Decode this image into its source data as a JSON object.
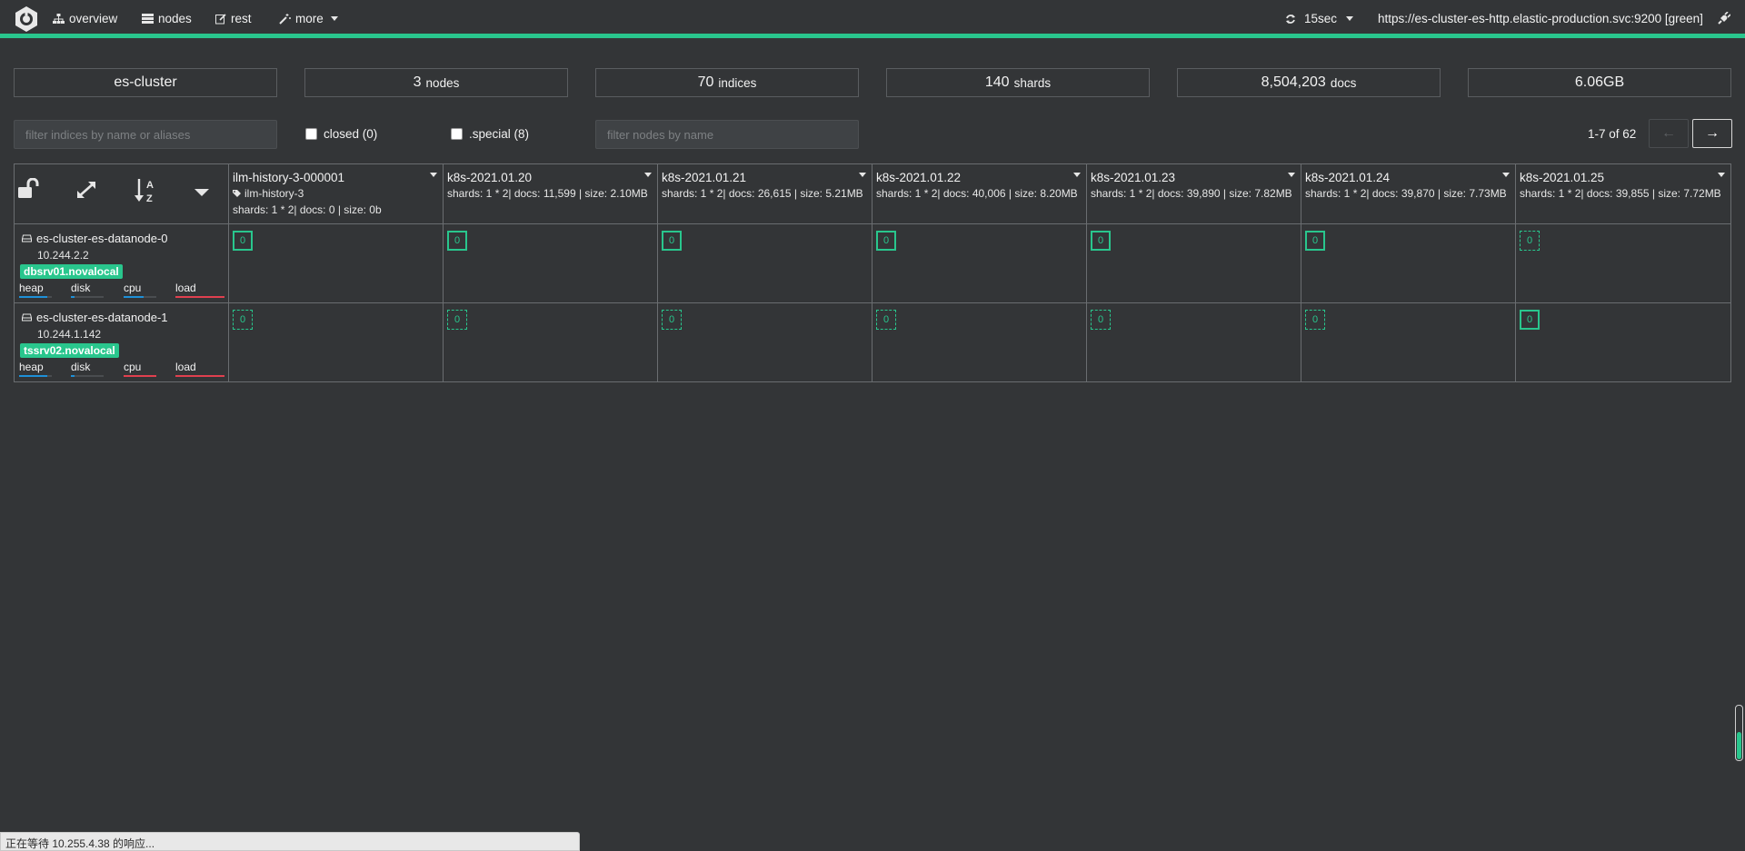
{
  "nav": {
    "items": [
      {
        "label": "overview",
        "icon": "sitemap-icon"
      },
      {
        "label": "nodes",
        "icon": "server-icon"
      },
      {
        "label": "rest",
        "icon": "edit-icon"
      },
      {
        "label": "more",
        "icon": "magic-wand-icon"
      }
    ],
    "refresh": "15sec",
    "cluster_url": "https://es-cluster-es-http.elastic-production.svc:9200 [green]"
  },
  "overview": {
    "cluster_name": "es-cluster",
    "nodes": {
      "value": "3",
      "unit": "nodes"
    },
    "indices": {
      "value": "70",
      "unit": "indices"
    },
    "shards": {
      "value": "140",
      "unit": "shards"
    },
    "docs": {
      "value": "8,504,203",
      "unit": "docs"
    },
    "size": "6.06GB"
  },
  "filters": {
    "indices_placeholder": "filter indices by name or aliases",
    "closed_label": "closed (0)",
    "special_label": ".special (8)",
    "nodes_placeholder": "filter nodes by name"
  },
  "pager": {
    "info": "1-7 of 62",
    "prev": "←",
    "next": "→"
  },
  "indices": [
    {
      "name": "ilm-history-3-000001",
      "alias": "ilm-history-3",
      "stats": "shards: 1 * 2| docs: 0 | size: 0b"
    },
    {
      "name": "k8s-2021.01.20",
      "alias": "",
      "stats": "shards: 1 * 2| docs: 11,599 | size: 2.10MB"
    },
    {
      "name": "k8s-2021.01.21",
      "alias": "",
      "stats": "shards: 1 * 2| docs: 26,615 | size: 5.21MB"
    },
    {
      "name": "k8s-2021.01.22",
      "alias": "",
      "stats": "shards: 1 * 2| docs: 40,006 | size: 8.20MB"
    },
    {
      "name": "k8s-2021.01.23",
      "alias": "",
      "stats": "shards: 1 * 2| docs: 39,890 | size: 7.82MB"
    },
    {
      "name": "k8s-2021.01.24",
      "alias": "",
      "stats": "shards: 1 * 2| docs: 39,870 | size: 7.73MB"
    },
    {
      "name": "k8s-2021.01.25",
      "alias": "",
      "stats": "shards: 1 * 2| docs: 39,855 | size: 7.72MB"
    }
  ],
  "nodes": [
    {
      "name": "es-cluster-es-datanode-0",
      "ip": "10.244.2.2",
      "host": "dbsrv01.novalocal",
      "metrics": [
        {
          "label": "heap",
          "level": 0.85,
          "color": "#1e90d8"
        },
        {
          "label": "disk",
          "level": 0.1,
          "color": "#1e90d8"
        },
        {
          "label": "cpu",
          "level": 0.6,
          "color": "#1e90d8"
        },
        {
          "label": "load",
          "level": 1.0,
          "color": "#e0404f"
        }
      ],
      "shards": [
        {
          "value": "0",
          "type": "primary"
        },
        {
          "value": "0",
          "type": "primary"
        },
        {
          "value": "0",
          "type": "primary"
        },
        {
          "value": "0",
          "type": "primary"
        },
        {
          "value": "0",
          "type": "primary"
        },
        {
          "value": "0",
          "type": "primary"
        },
        {
          "value": "0",
          "type": "replica"
        }
      ]
    },
    {
      "name": "es-cluster-es-datanode-1",
      "ip": "10.244.1.142",
      "host": "tssrv02.novalocal",
      "metrics": [
        {
          "label": "heap",
          "level": 0.85,
          "color": "#1e90d8"
        },
        {
          "label": "disk",
          "level": 0.1,
          "color": "#1e90d8"
        },
        {
          "label": "cpu",
          "level": 1.0,
          "color": "#e0404f"
        },
        {
          "label": "load",
          "level": 1.0,
          "color": "#e0404f"
        }
      ],
      "shards": [
        {
          "value": "0",
          "type": "replica"
        },
        {
          "value": "0",
          "type": "replica"
        },
        {
          "value": "0",
          "type": "replica"
        },
        {
          "value": "0",
          "type": "replica"
        },
        {
          "value": "0",
          "type": "replica"
        },
        {
          "value": "0",
          "type": "replica"
        },
        {
          "value": "0",
          "type": "primary"
        }
      ]
    }
  ],
  "statusbar": "正在等待 10.255.4.38 的响应..."
}
